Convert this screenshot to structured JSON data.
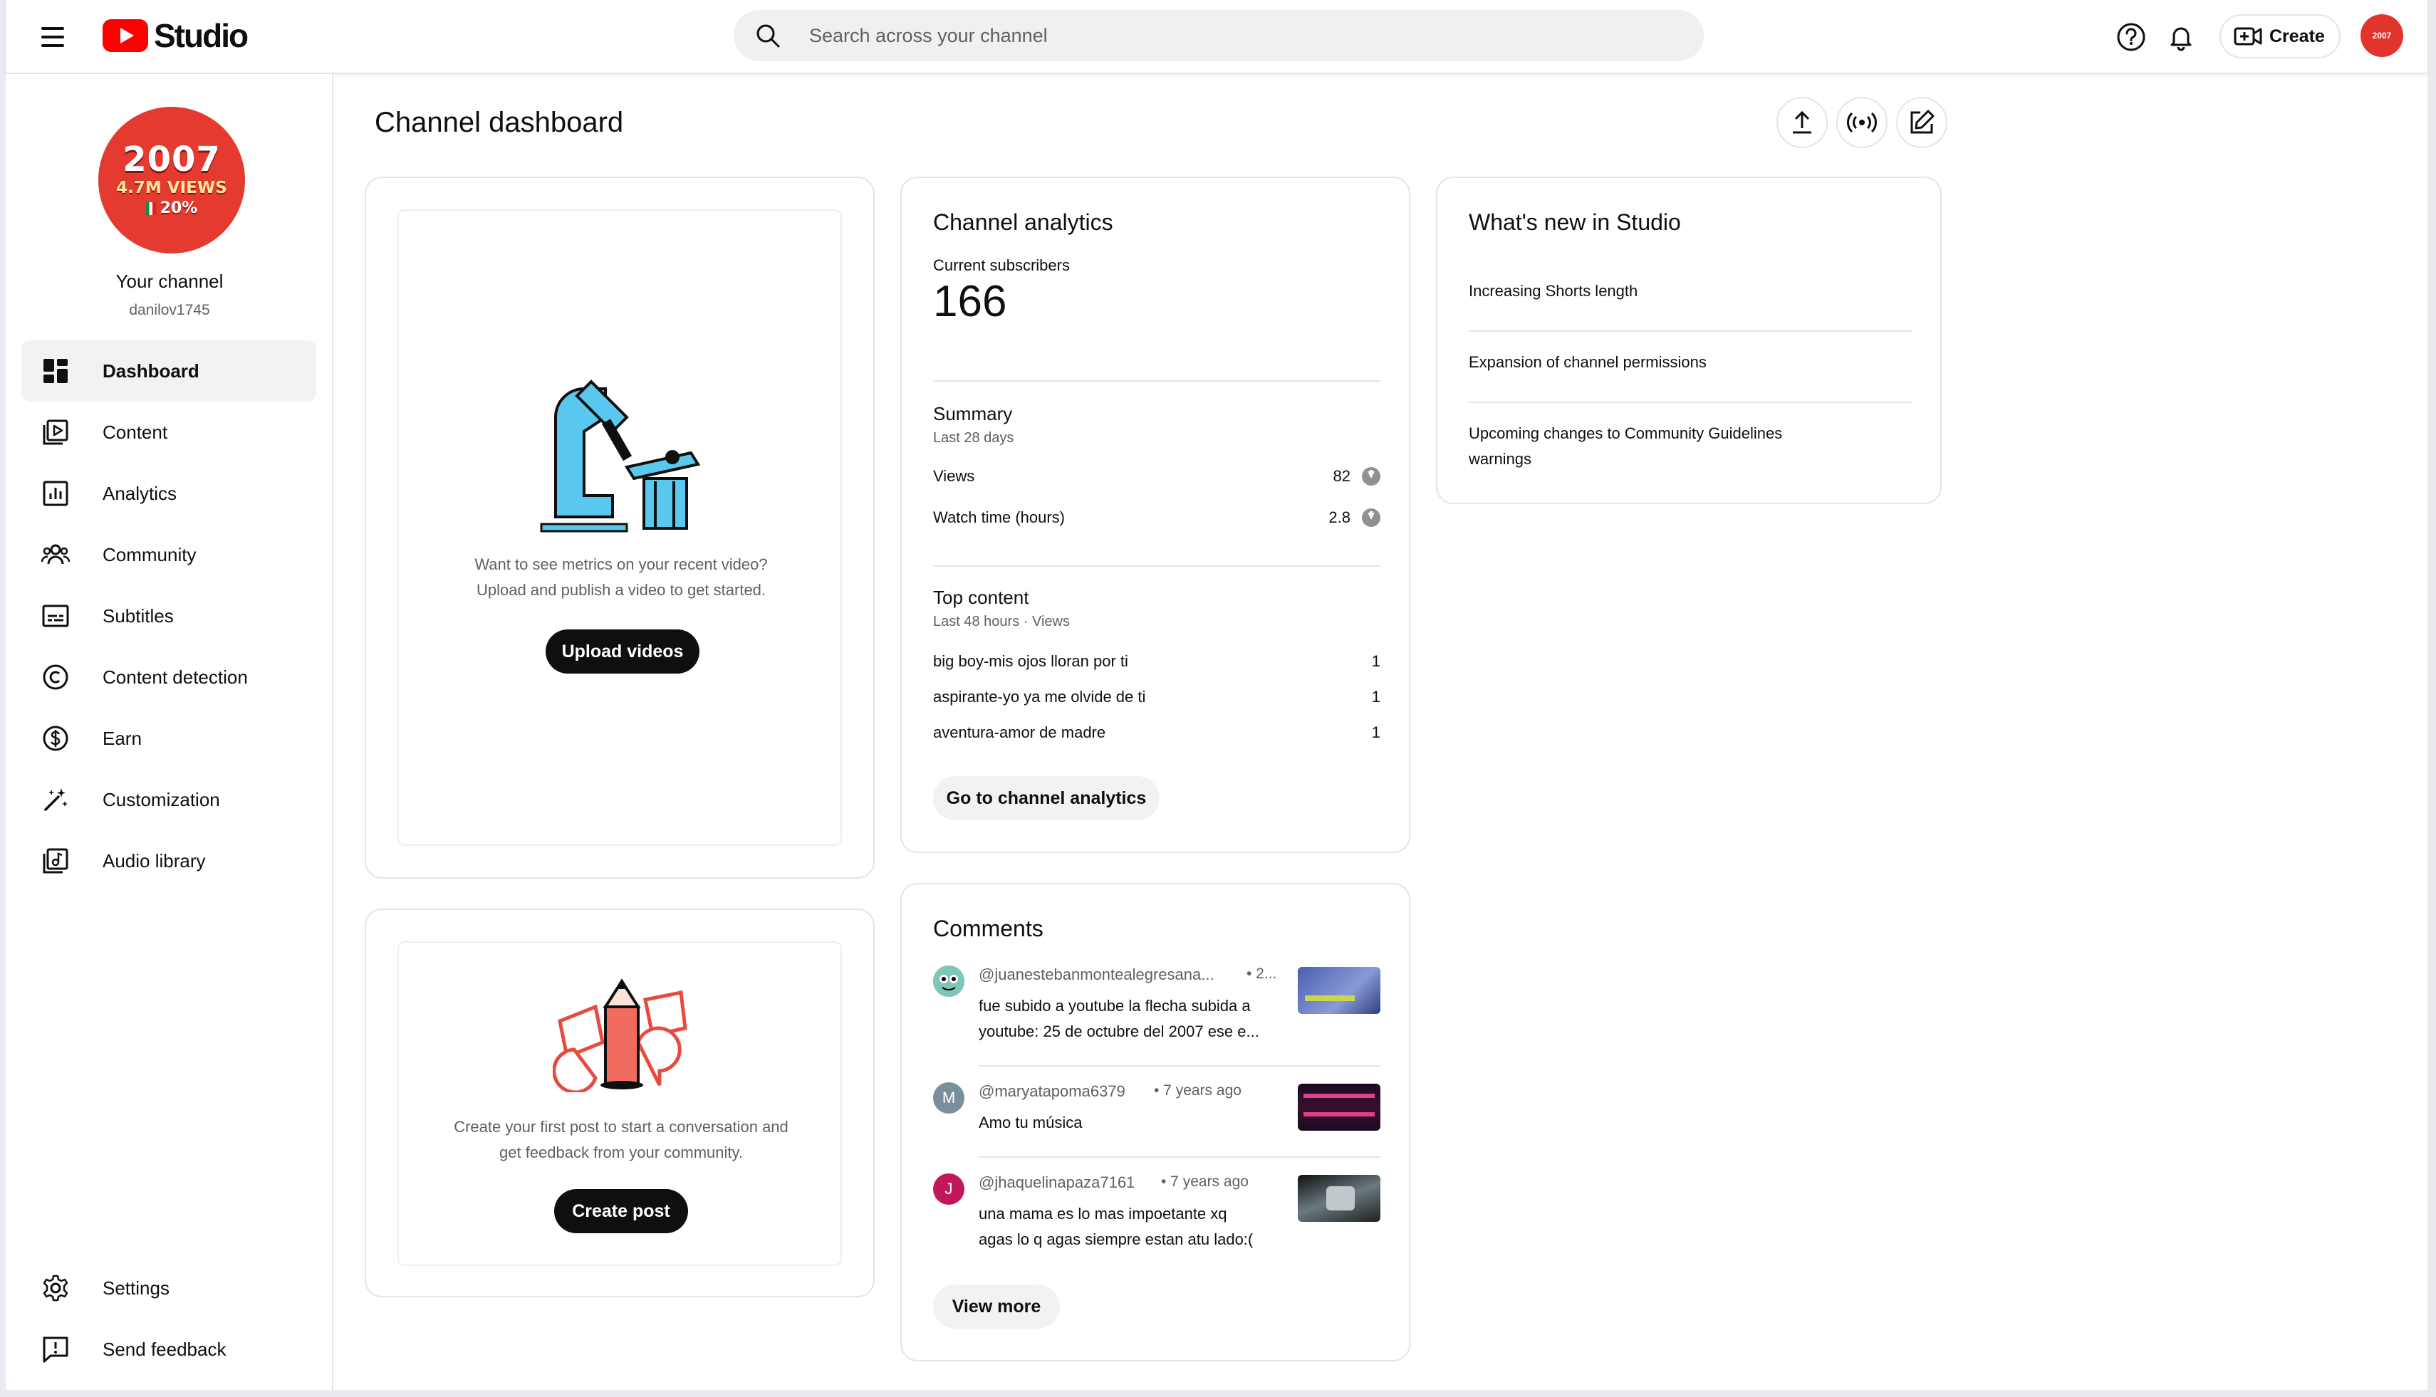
{
  "app": {
    "logo_text": "Studio"
  },
  "search": {
    "placeholder": "Search across your channel"
  },
  "header": {
    "create_label": "Create",
    "avatar_text": "2007"
  },
  "sidebar": {
    "channel_avatar": {
      "year": "2007",
      "views": "4.7M VIEWS",
      "pct": "20%"
    },
    "channel_name": "Your channel",
    "channel_handle": "danilov1745",
    "items": [
      {
        "label": "Dashboard",
        "icon": "dashboard-icon",
        "active": true
      },
      {
        "label": "Content",
        "icon": "content-icon"
      },
      {
        "label": "Analytics",
        "icon": "analytics-icon"
      },
      {
        "label": "Community",
        "icon": "community-icon"
      },
      {
        "label": "Subtitles",
        "icon": "subtitles-icon"
      },
      {
        "label": "Content detection",
        "icon": "copyright-icon"
      },
      {
        "label": "Earn",
        "icon": "dollar-icon"
      },
      {
        "label": "Customization",
        "icon": "magic-wand-icon"
      },
      {
        "label": "Audio library",
        "icon": "audio-library-icon"
      }
    ],
    "bottom_items": [
      {
        "label": "Settings",
        "icon": "gear-icon"
      },
      {
        "label": "Send feedback",
        "icon": "feedback-icon"
      }
    ]
  },
  "main": {
    "title": "Channel dashboard",
    "upload_card": {
      "text_line1": "Want to see metrics on your recent video?",
      "text_line2": "Upload and publish a video to get started.",
      "button": "Upload videos"
    },
    "post_card": {
      "text_line1": "Create your first post to start a conversation and",
      "text_line2": "get feedback from your community.",
      "button": "Create post"
    },
    "analytics": {
      "title": "Channel analytics",
      "subscribers_label": "Current subscribers",
      "subscribers_value": "166",
      "summary_title": "Summary",
      "summary_period": "Last 28 days",
      "rows": [
        {
          "label": "Views",
          "value": "82"
        },
        {
          "label": "Watch time (hours)",
          "value": "2.8"
        }
      ],
      "top_title": "Top content",
      "top_period": "Last 48 hours · Views",
      "top_items": [
        {
          "title": "big boy-mis ojos lloran por ti",
          "views": "1"
        },
        {
          "title": "aspirante-yo ya me olvide de ti",
          "views": "1"
        },
        {
          "title": "aventura-amor de madre",
          "views": "1"
        }
      ],
      "button": "Go to channel analytics"
    },
    "comments": {
      "title": "Comments",
      "items": [
        {
          "author": "@juanestebanmontealegresana...",
          "time": "• 2...",
          "line1": "fue subido a youtube la flecha subida a",
          "line2": "youtube: 25 de octubre del 2007 ese e...",
          "avatar": "",
          "avatar_color": "#4a9a8a"
        },
        {
          "author": "@maryatapoma6379",
          "time": "• 7 years ago",
          "line1": "Amo tu música",
          "line2": "",
          "avatar": "M",
          "avatar_color": "#78909c"
        },
        {
          "author": "@jhaquelinapaza7161",
          "time": "• 7 years ago",
          "line1": "una mama es lo mas impoetante xq",
          "line2": "agas lo q agas siempre estan atu lado:(",
          "avatar": "J",
          "avatar_color": "#c2185b"
        }
      ],
      "button": "View more"
    },
    "whats_new": {
      "title": "What's new in Studio",
      "items": [
        {
          "line1": "Increasing Shorts length",
          "line2": ""
        },
        {
          "line1": "Expansion of channel permissions",
          "line2": ""
        },
        {
          "line1": "Upcoming changes to Community Guidelines",
          "line2": "warnings"
        }
      ]
    }
  },
  "colors": {
    "brand_red": "#ff0000",
    "accent_dark": "#0f0f0f",
    "muted": "#606060"
  }
}
